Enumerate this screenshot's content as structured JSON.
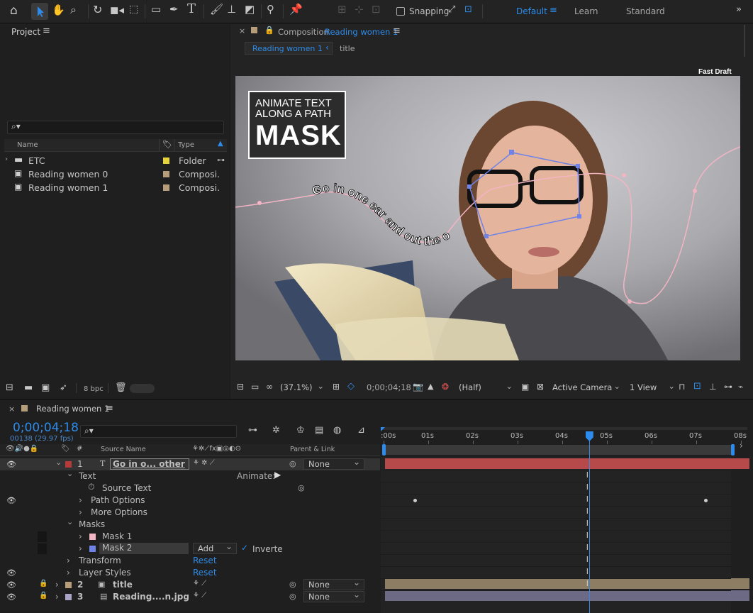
{
  "toolbar": {
    "snapping_label": "Snapping",
    "workspaces": [
      "Default",
      "Learn",
      "Standard"
    ],
    "active_workspace": "Default",
    "accent": "#2d8ceb"
  },
  "project": {
    "title": "Project",
    "search_placeholder": "",
    "columns": {
      "name": "Name",
      "type": "Type"
    },
    "items": [
      {
        "name": "ETC",
        "type": "Folder",
        "color": "#e6d23a",
        "icon": "folder-icon"
      },
      {
        "name": "Reading women 0",
        "type": "Composi.",
        "color": "#b79e7a",
        "icon": "composition-icon"
      },
      {
        "name": "Reading women 1",
        "type": "Composi.",
        "color": "#b79e7a",
        "icon": "composition-icon"
      }
    ],
    "bpc": "8 bpc"
  },
  "composition": {
    "panel_label": "Composition",
    "comp_name": "Reading women 1",
    "breadcrumbs": [
      "Reading women 1",
      "title"
    ],
    "fast_draft": "Fast Draft",
    "title_card": {
      "line1": "ANIMATE TEXT",
      "line2": "ALONG A PATH",
      "line3": "MASK"
    },
    "path_text": "Go in one ear and out the o",
    "zoom": "(37.1%)",
    "timecode": "0;00;04;18",
    "resolution": "(Half)",
    "camera": "Active Camera",
    "views": "1 View"
  },
  "timeline": {
    "comp_tab": "Reading women 1",
    "timecode": "0;00;04;18",
    "frame_info": "00138 (29.97 fps)",
    "columns": {
      "source_name": "Source Name",
      "parent": "Parent & Link"
    },
    "ruler": [
      ":00s",
      "01s",
      "02s",
      "03s",
      "04s",
      "05s",
      "06s",
      "07s",
      "08s"
    ],
    "playhead_seconds": 4.6,
    "layers": [
      {
        "num": "1",
        "name": "Go in o... other",
        "parent": "None",
        "color": "#b53a3a"
      },
      {
        "num": "2",
        "name": "title",
        "parent": "None",
        "color": "#b79e7a"
      },
      {
        "num": "3",
        "name": "Reading....n.jpg",
        "parent": "None",
        "color": "#a9a5c9"
      }
    ],
    "props": {
      "text": "Text",
      "animate": "Animate:",
      "source_text": "Source Text",
      "path_options": "Path Options",
      "more_options": "More Options",
      "masks": "Masks",
      "mask1": "Mask 1",
      "mask2": "Mask 2",
      "mask_mode": "Add",
      "inverted": "Inverte",
      "transform": "Transform",
      "layer_styles": "Layer Styles",
      "reset": "Reset"
    },
    "keyframe_seconds": [
      0.7,
      7.2
    ]
  }
}
